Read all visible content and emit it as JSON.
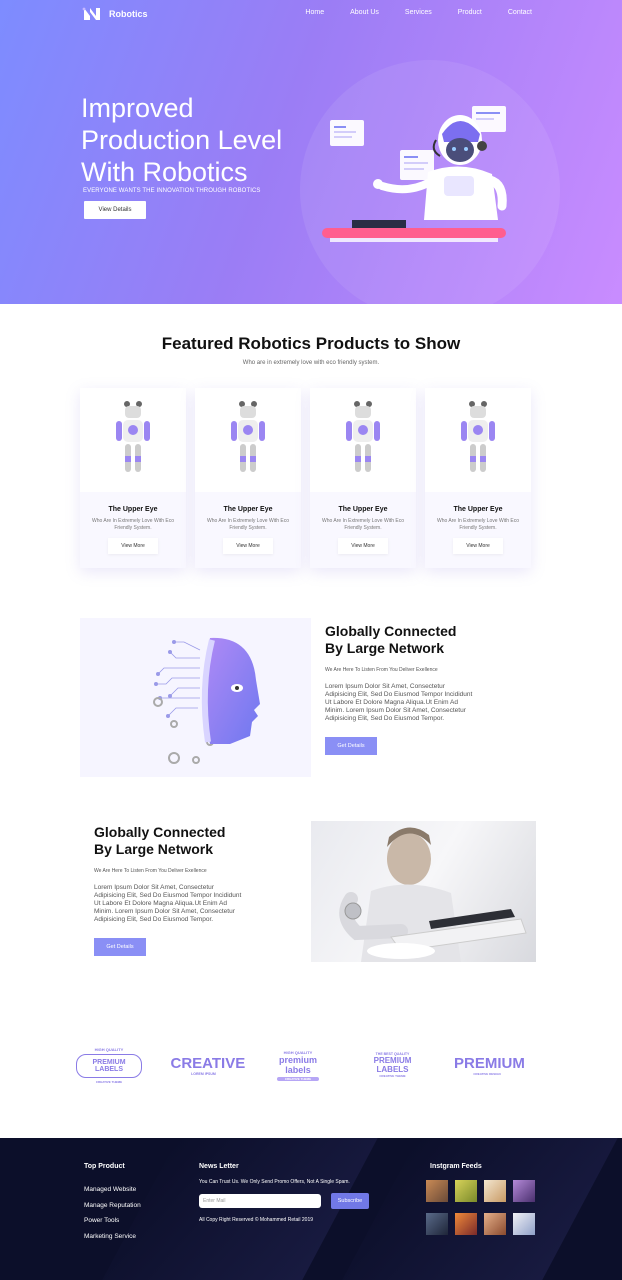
{
  "nav": {
    "brand": "Robotics",
    "links": [
      "Home",
      "About Us",
      "Services",
      "Product",
      "Contact"
    ]
  },
  "hero": {
    "title": "Improved Production Level With Robotics",
    "subtitle": "EVERYONE WANTS THE INNOVATION THROUGH ROBOTICS",
    "button": "View Details"
  },
  "featured": {
    "title": "Featured Robotics Products to Show",
    "subtitle": "Who are in extremely love with eco friendly system.",
    "cards": [
      {
        "title": "The Upper Eye",
        "desc": "Who Are In Extremely Love With Eco Friendly System.",
        "button": "View More"
      },
      {
        "title": "The Upper Eye",
        "desc": "Who Are In Extremely Love With Eco Friendly System.",
        "button": "View More"
      },
      {
        "title": "The Upper Eye",
        "desc": "Who Are In Extremely Love With Eco Friendly System.",
        "button": "View More"
      },
      {
        "title": "The Upper Eye",
        "desc": "Who Are In Extremely Love With Eco Friendly System.",
        "button": "View More"
      }
    ]
  },
  "section_a": {
    "title": "Globally Connected By Large Network",
    "tag": "We Are Here To Listen From You Deliver Exellence",
    "paragraph": "Lorem Ipsum Dolor Sit Amet, Consectetur Adipisicing Elit, Sed Do Eiusmod Tempor Incididunt Ut Labore Et Dolore Magna Aliqua.Ut Enim Ad Minim. Lorem Ipsum Dolor Sit Amet, Consectetur Adipisicing Elit, Sed Do Eiusmod Tempor.",
    "button": "Get Details"
  },
  "section_b": {
    "title": "Globally Connected By Large Network",
    "tag": "We Are Here To Listen From You Deliver Exellence",
    "paragraph": "Lorem Ipsum Dolor Sit Amet, Consectetur Adipisicing Elit, Sed Do Eiusmod Tempor Incididunt Ut Labore Et Dolore Magna Aliqua.Ut Enim Ad Minim. Lorem Ipsum Dolor Sit Amet, Consectetur Adipisicing Elit, Sed Do Eiusmod Tempor.",
    "button": "Get Details"
  },
  "brands": [
    {
      "top": "HIGH QUALITY",
      "main": "PREMIUM LABELS",
      "bottom": "CREATIVE THEME"
    },
    {
      "main": "CREATIVE",
      "bottom": "LOREM IPSUM"
    },
    {
      "top": "HIGH QUALITY",
      "main": "premium labels",
      "bottom": "CREATIVE THEME"
    },
    {
      "top": "THE BEST QUALITY",
      "main": "PREMIUM LABELS",
      "bottom": "CREATIVE THEME"
    },
    {
      "main": "PREMIUM",
      "bottom": "CREATIVE DESIGN"
    }
  ],
  "footer": {
    "top_product_title": "Top Product",
    "top_product_links": [
      "Managed Website",
      "Manage Reputation",
      "Power Tools",
      "Marketing Service"
    ],
    "newsletter_title": "News Letter",
    "newsletter_text": "You Can Trust Us. We Only Send Promo Offers, Not A Single Spam.",
    "email_placeholder": "Enter Mail",
    "subscribe_button": "Subscribe",
    "copyright": "All Copy Right Reserved © Mohammed Retail 2019",
    "instagram_title": "Instgram Feeds"
  },
  "colors": {
    "accent": "#8a8ff5",
    "hero_start": "#7d8cff",
    "hero_end": "#c98cff",
    "footer_bg": "#0c0f2a"
  }
}
